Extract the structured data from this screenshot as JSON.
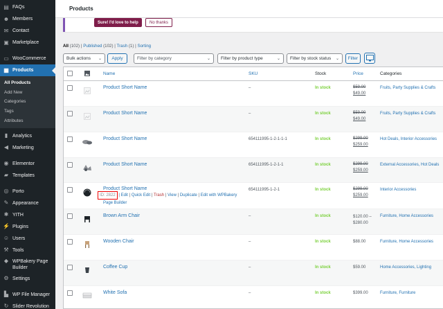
{
  "sidebar": {
    "items": [
      {
        "label": "FAQs",
        "icon": "faq-icon"
      },
      {
        "label": "Members",
        "icon": "members-icon"
      },
      {
        "label": "Contact",
        "icon": "envelope-icon"
      },
      {
        "label": "Marketplace",
        "icon": "marketplace-icon"
      },
      {
        "label": "WooCommerce",
        "icon": "woocommerce-icon"
      },
      {
        "label": "Products",
        "icon": "archive-icon",
        "active": true
      },
      {
        "label": "Analytics",
        "icon": "chart-bar-icon"
      },
      {
        "label": "Marketing",
        "icon": "megaphone-icon"
      },
      {
        "label": "Elementor",
        "icon": "elementor-icon"
      },
      {
        "label": "Templates",
        "icon": "folder-icon"
      },
      {
        "label": "Porto",
        "icon": "porto-icon"
      },
      {
        "label": "Appearance",
        "icon": "paintbrush-icon"
      },
      {
        "label": "YITH",
        "icon": "yith-icon"
      },
      {
        "label": "Plugins",
        "icon": "plugin-icon"
      },
      {
        "label": "Users",
        "icon": "users-icon"
      },
      {
        "label": "Tools",
        "icon": "wrench-icon"
      },
      {
        "label": "WPBakery Page Builder",
        "icon": "wpbakery-icon"
      },
      {
        "label": "Settings",
        "icon": "settings-icon"
      },
      {
        "label": "WP File Manager",
        "icon": "file-manager-icon"
      },
      {
        "label": "Slider Revolution",
        "icon": "slider-icon"
      }
    ],
    "submenu": [
      "All Products",
      "Add New",
      "Categories",
      "Tags",
      "Attributes"
    ]
  },
  "header": {
    "title": "Products"
  },
  "notice": {
    "primary_button": "Sure! I'd love to help",
    "secondary_button": "No thanks"
  },
  "views": {
    "all": "All",
    "all_count": "(102)",
    "published": "Published",
    "published_count": "(102)",
    "trash": "Trash",
    "trash_count": "(1)",
    "sorting": "Sorting",
    "sep": "|"
  },
  "tablenav": {
    "bulk_actions": "Bulk actions",
    "apply": "Apply",
    "filter_category": "Filter by category",
    "filter_type": "Filter by product type",
    "filter_stock": "Filter by stock status",
    "filter_button": "Filter"
  },
  "columns": {
    "name": "Name",
    "sku": "SKU",
    "stock": "Stock",
    "price": "Price",
    "categories": "Categories"
  },
  "rows": [
    {
      "name": "Product Short Name",
      "sku": "–",
      "stock": "In stock",
      "price_regular": "$59.00",
      "price_sale": "$49.00",
      "categories": "Fruits, Party Supplies & Crafts"
    },
    {
      "name": "Product Short Name",
      "sku": "–",
      "stock": "In stock",
      "price_regular": "$59.00",
      "price_sale": "$49.00",
      "categories": "Fruits, Party Supplies & Crafts"
    },
    {
      "name": "Product Short Name",
      "sku": "654111995-1-2-1-1-1",
      "stock": "In stock",
      "price_regular": "$299.00",
      "price_sale": "$259.00",
      "categories": "Hot Deals, Interior Accessories"
    },
    {
      "name": "Product Short Name",
      "sku": "654111995-1-2-1-1",
      "stock": "In stock",
      "price_regular": "$299.00",
      "price_sale": "$259.00",
      "categories": "External Accessories, Hot Deals"
    },
    {
      "name": "Product Short Name",
      "sku": "654111995-1-2-1",
      "stock": "In stock",
      "price_regular": "$299.00",
      "price_sale": "$259.00",
      "categories": "Interior Accessories",
      "row_actions": {
        "id": "ID: 2822",
        "edit": "Edit",
        "quick_edit": "Quick Edit",
        "trash": "Trash",
        "view": "View",
        "duplicate": "Duplicate",
        "wpbakery": "Edit with WPBakery Page Builder",
        "sep": "|"
      }
    },
    {
      "name": "Brown Arm Chair",
      "sku": "–",
      "stock": "In stock",
      "price_range_1": "$120.00 –",
      "price_range_2": "$280.00",
      "categories": "Furniture, Home Accessories"
    },
    {
      "name": "Wooden Chair",
      "sku": "–",
      "stock": "In stock",
      "price_one": "$88.00",
      "categories": "Furniture, Home Accessories"
    },
    {
      "name": "Coffee Cup",
      "sku": "–",
      "stock": "In stock",
      "price_one": "$59.00",
      "categories": "Home Accessories, Lighting"
    },
    {
      "name": "White Sofa",
      "sku": "–",
      "stock": "In stock",
      "price_one": "$399.00",
      "categories": "Furniture, Furniture"
    }
  ],
  "colors": {
    "admin_bg": "#1d2327",
    "accent": "#2271b1",
    "in_stock": "#7ad03a",
    "notice_accent": "#7f1d4a"
  }
}
